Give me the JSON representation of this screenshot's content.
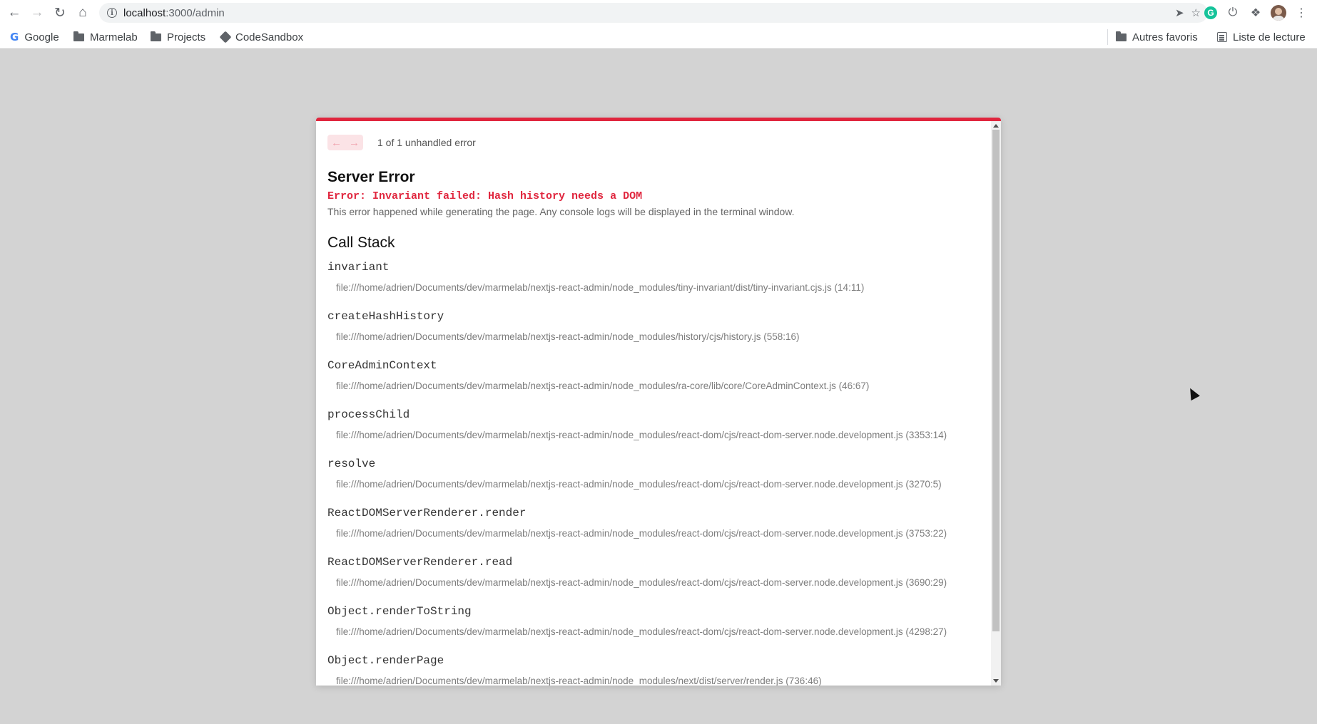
{
  "browser": {
    "url_host": "localhost",
    "url_path": ":3000/admin",
    "bookmarks": [
      {
        "label": "Google",
        "icon": "google-icon"
      },
      {
        "label": "Marmelab",
        "icon": "folder-icon"
      },
      {
        "label": "Projects",
        "icon": "folder-icon"
      },
      {
        "label": "CodeSandbox",
        "icon": "codesandbox-icon"
      }
    ],
    "bookmarks_right": [
      {
        "label": "Autres favoris",
        "icon": "folder-icon"
      },
      {
        "label": "Liste de lecture",
        "icon": "reading-list-icon"
      }
    ]
  },
  "overlay": {
    "accent_color": "#e0263e",
    "pager_text": "1 of 1 unhandled error",
    "title": "Server Error",
    "error_message": "Error: Invariant failed: Hash history needs a DOM",
    "description": "This error happened while generating the page. Any console logs will be displayed in the terminal window.",
    "call_stack_title": "Call Stack",
    "frames": [
      {
        "fn": "invariant",
        "file": "file:///home/adrien/Documents/dev/marmelab/nextjs-react-admin/node_modules/tiny-invariant/dist/tiny-invariant.cjs.js (14:11)"
      },
      {
        "fn": "createHashHistory",
        "file": "file:///home/adrien/Documents/dev/marmelab/nextjs-react-admin/node_modules/history/cjs/history.js (558:16)"
      },
      {
        "fn": "CoreAdminContext",
        "file": "file:///home/adrien/Documents/dev/marmelab/nextjs-react-admin/node_modules/ra-core/lib/core/CoreAdminContext.js (46:67)"
      },
      {
        "fn": "processChild",
        "file": "file:///home/adrien/Documents/dev/marmelab/nextjs-react-admin/node_modules/react-dom/cjs/react-dom-server.node.development.js (3353:14)"
      },
      {
        "fn": "resolve",
        "file": "file:///home/adrien/Documents/dev/marmelab/nextjs-react-admin/node_modules/react-dom/cjs/react-dom-server.node.development.js (3270:5)"
      },
      {
        "fn": "ReactDOMServerRenderer.render",
        "file": "file:///home/adrien/Documents/dev/marmelab/nextjs-react-admin/node_modules/react-dom/cjs/react-dom-server.node.development.js (3753:22)"
      },
      {
        "fn": "ReactDOMServerRenderer.read",
        "file": "file:///home/adrien/Documents/dev/marmelab/nextjs-react-admin/node_modules/react-dom/cjs/react-dom-server.node.development.js (3690:29)"
      },
      {
        "fn": "Object.renderToString",
        "file": "file:///home/adrien/Documents/dev/marmelab/nextjs-react-admin/node_modules/react-dom/cjs/react-dom-server.node.development.js (4298:27)"
      },
      {
        "fn": "Object.renderPage",
        "file": "file:///home/adrien/Documents/dev/marmelab/nextjs-react-admin/node_modules/next/dist/server/render.js (736:46)"
      }
    ]
  }
}
